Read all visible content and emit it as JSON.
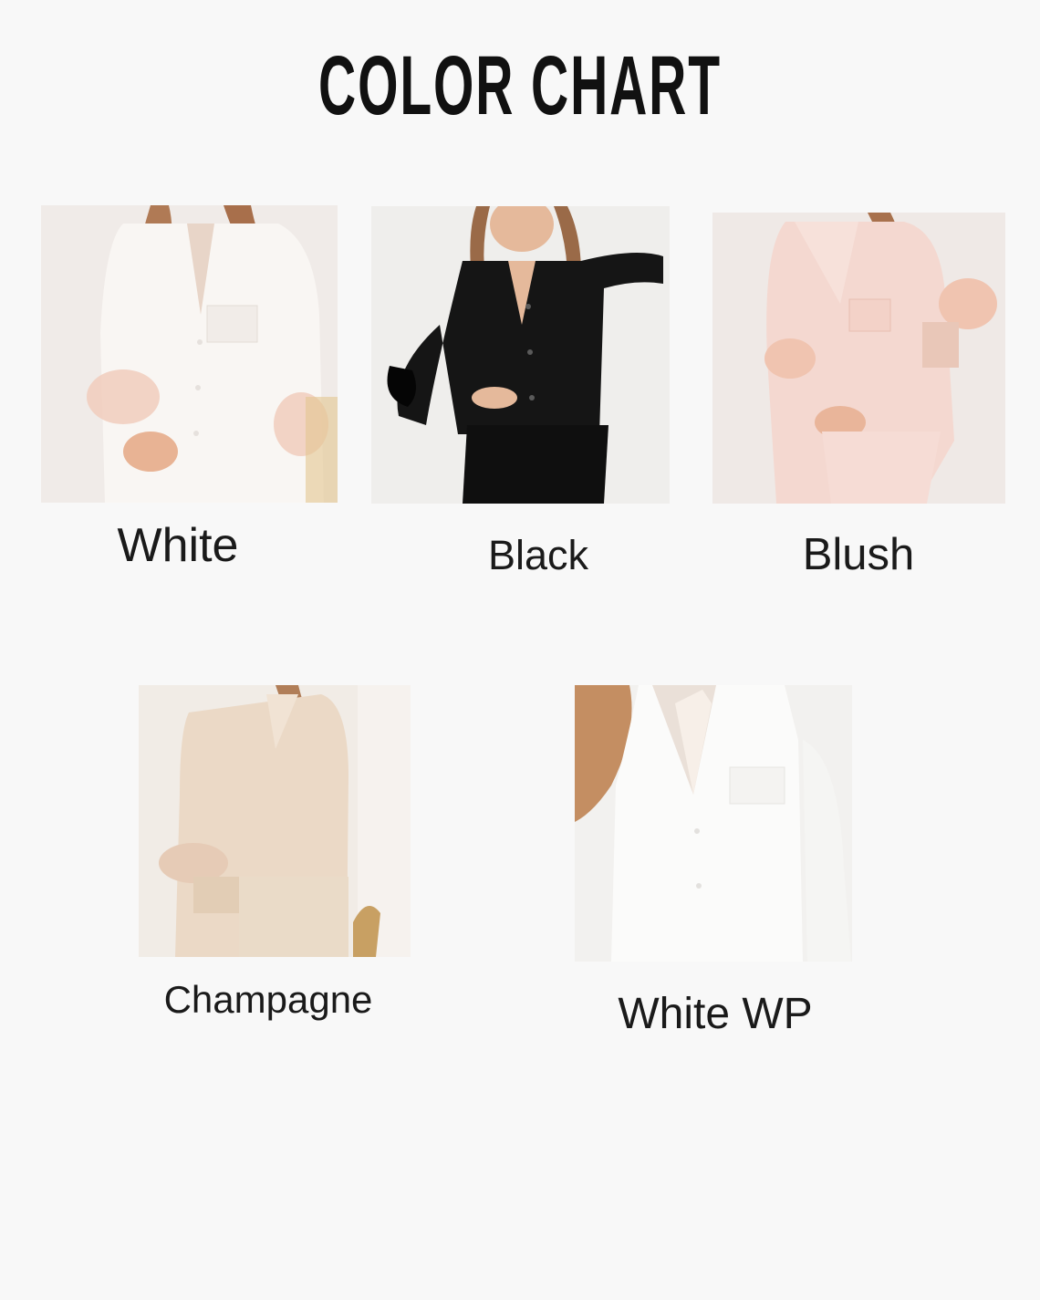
{
  "title": "COLOR CHART",
  "colors": [
    {
      "label": "White",
      "icon": "white-pajama-photo",
      "shirt": "#f7f4f1",
      "feather": "#f1cdbc"
    },
    {
      "label": "Black",
      "icon": "black-pajama-photo",
      "shirt": "#141414",
      "feather": "#0a0a0a"
    },
    {
      "label": "Blush",
      "icon": "blush-pajama-photo",
      "shirt": "#f4d9d2",
      "feather": "#f0c4b0"
    },
    {
      "label": "Champagne",
      "icon": "champagne-pajama-photo",
      "shirt": "#ead9c6",
      "feather": "#e6cbb6"
    },
    {
      "label": "White WP",
      "icon": "white-wp-pajama-photo",
      "shirt": "#fbfbfa",
      "feather": "#ffffff"
    }
  ]
}
